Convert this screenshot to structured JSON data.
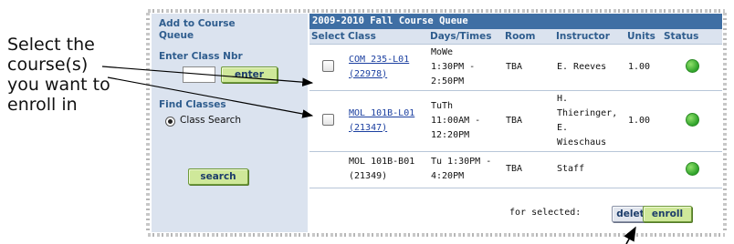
{
  "callout": {
    "lines": [
      "Select the",
      "course(s)",
      "you want to",
      "enroll in"
    ]
  },
  "left_panel": {
    "add_heading": "Add to Course Queue",
    "enter_class_label": "Enter Class Nbr",
    "class_nbr_value": "",
    "enter_button": "enter",
    "find_classes_label": "Find Classes",
    "class_search_label": "Class Search",
    "search_button": "search"
  },
  "queue": {
    "title": "2009-2010 Fall Course Queue",
    "columns": [
      "Select",
      "Class",
      "Days/Times",
      "Room",
      "Instructor",
      "Units",
      "Status"
    ],
    "rows": [
      {
        "selectable": true,
        "class_line1": "COM 235-L01",
        "class_line2": "(22978)",
        "class_is_link": true,
        "days_line1": "MoWe",
        "days_line2": "1:30PM -",
        "days_line3": "2:50PM",
        "room": "TBA",
        "instructor_line1": "E. Reeves",
        "instructor_line2": "",
        "instructor_line3": "",
        "instructor_line4": "",
        "units": "1.00",
        "status": "open"
      },
      {
        "selectable": true,
        "class_line1": "MOL 101B-L01",
        "class_line2": "(21347)",
        "class_is_link": true,
        "days_line1": "TuTh",
        "days_line2": "11:00AM -",
        "days_line3": "12:20PM",
        "room": "TBA",
        "instructor_line1": "H.",
        "instructor_line2": "Thieringer,",
        "instructor_line3": "E.",
        "instructor_line4": "Wieschaus",
        "units": "1.00",
        "status": "open"
      },
      {
        "selectable": false,
        "class_line1": "MOL 101B-B01",
        "class_line2": "(21349)",
        "class_is_link": false,
        "days_line1": "Tu 1:30PM -",
        "days_line2": "4:20PM",
        "days_line3": "",
        "room": "TBA",
        "instructor_line1": "Staff",
        "instructor_line2": "",
        "instructor_line3": "",
        "instructor_line4": "",
        "units": "",
        "status": "open"
      }
    ],
    "for_selected_label": "for selected:",
    "delete_button": "delete",
    "enroll_button": "enroll"
  },
  "colors": {
    "title_bar": "#3f6fa4",
    "panel": "#dbe3ef",
    "label_blue": "#2f5d8e",
    "status_open": "#2ea22a",
    "button_green": "#cfe89a"
  }
}
